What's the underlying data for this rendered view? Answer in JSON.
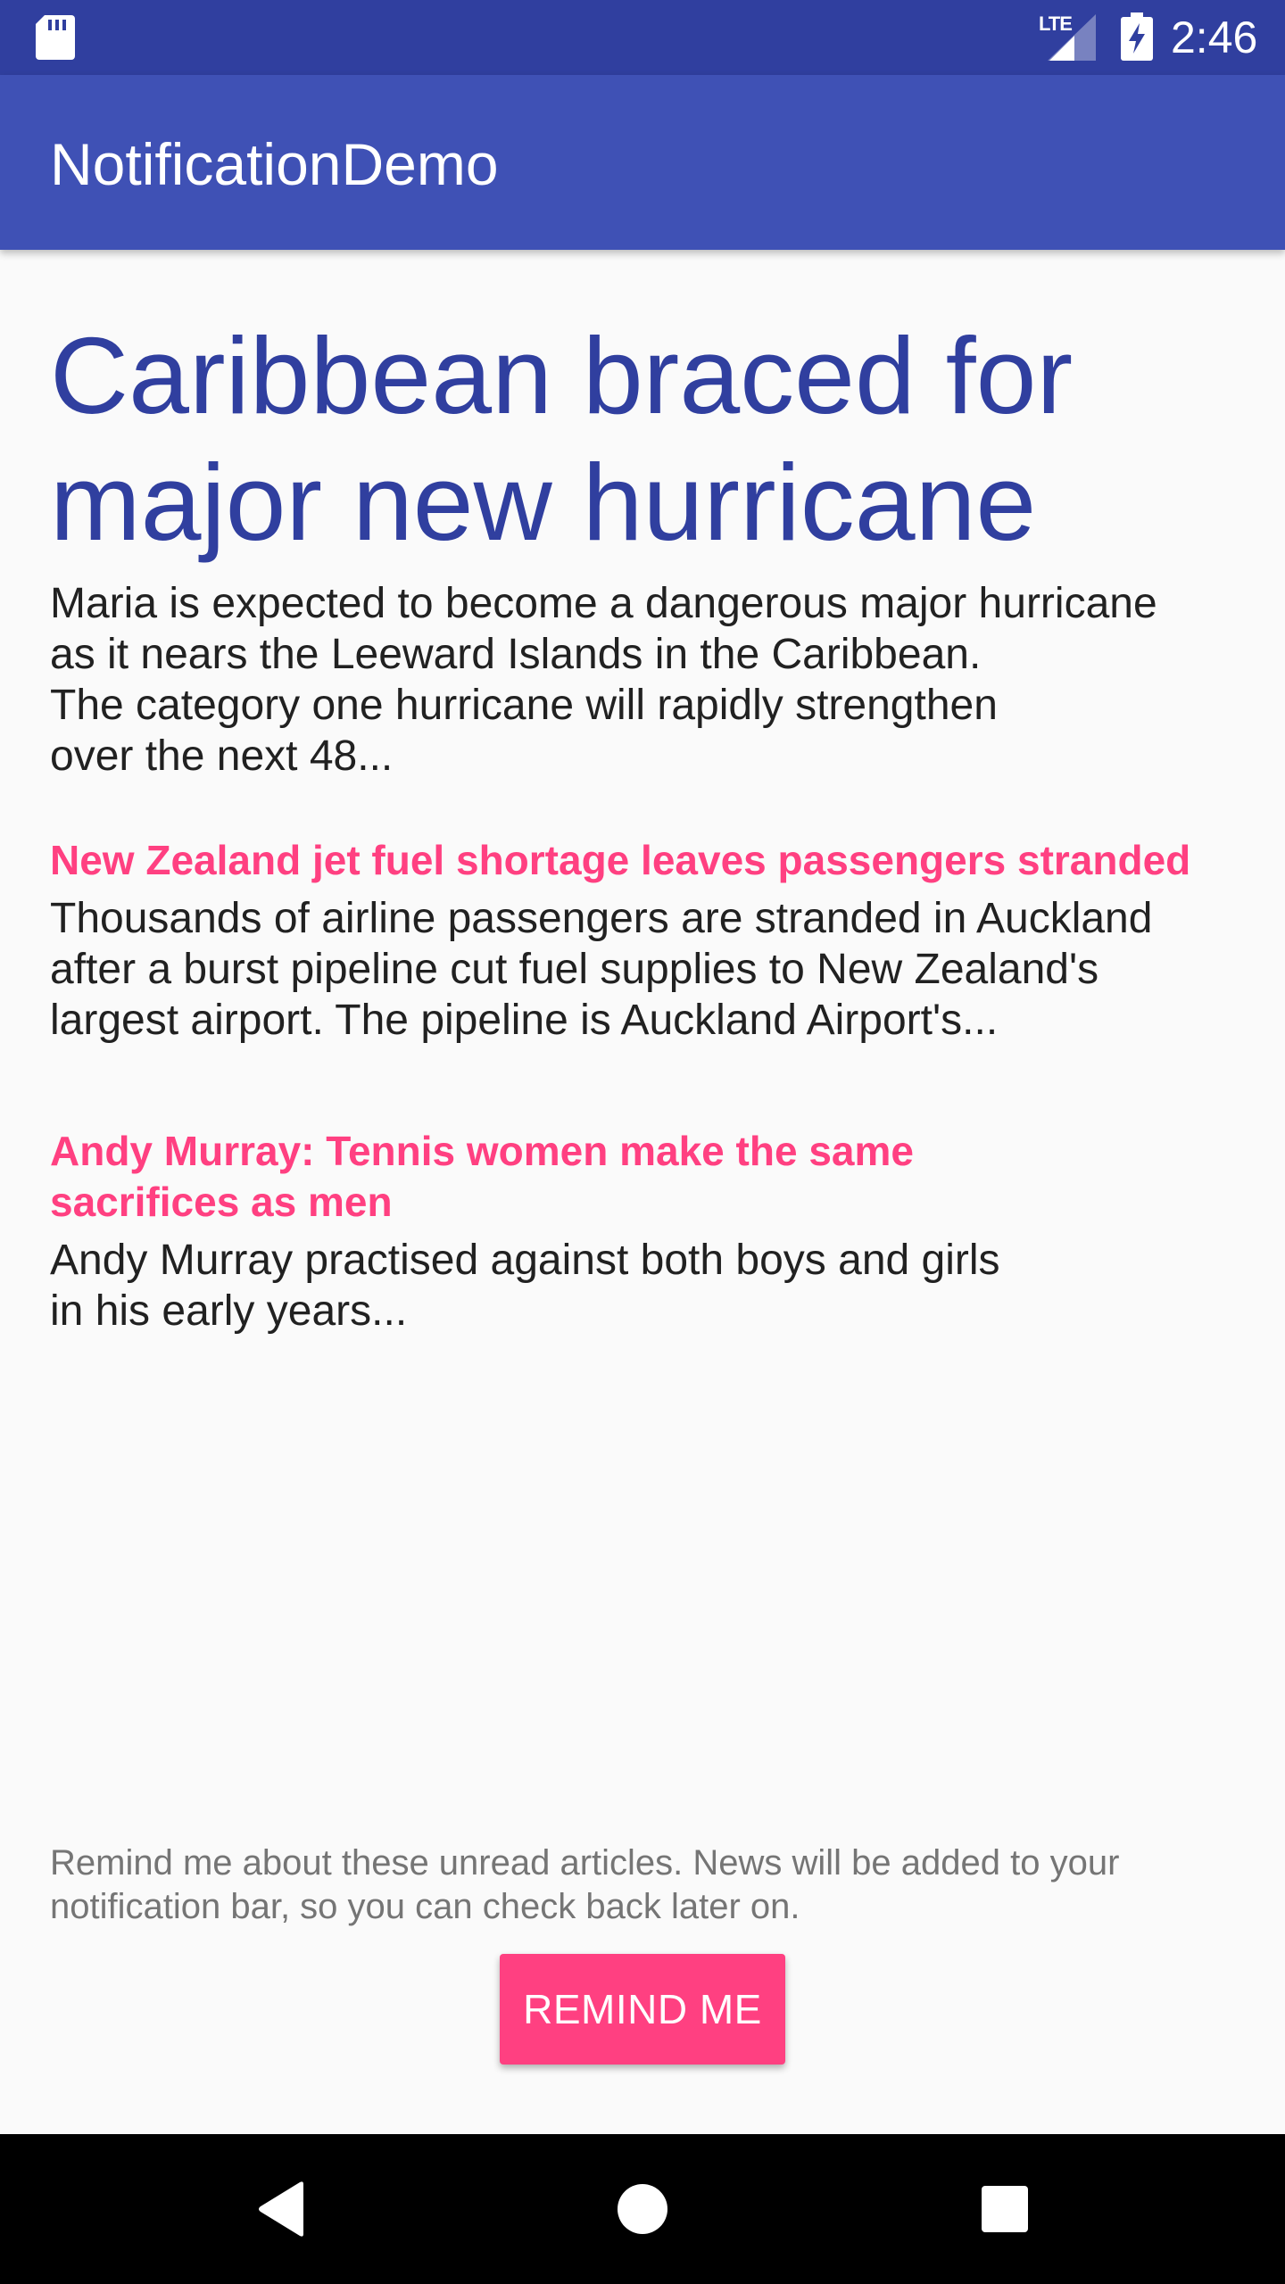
{
  "status_bar": {
    "network_label": "LTE",
    "time": "2:46",
    "icons": [
      "sd-card-icon",
      "signal-icon",
      "battery-charging-icon"
    ]
  },
  "app_bar": {
    "title": "NotificationDemo"
  },
  "headline": {
    "title": "Caribbean braced for major new hurricane",
    "body": "Maria is expected to become a dangerous major hurricane\nas it nears the Leeward Islands in the Caribbean.\nThe category one hurricane will rapidly strengthen\nover the next 48..."
  },
  "articles": [
    {
      "title": "New Zealand jet fuel shortage leaves passengers stranded",
      "body": "Thousands of airline passengers are stranded in Auckland\nafter a burst pipeline cut fuel supplies to New Zealand's\nlargest airport. The pipeline is Auckland Airport's..."
    },
    {
      "title": "Andy Murray: Tennis women make the same\nsacrifices as men",
      "body": "Andy Murray practised against both boys and girls\nin his early years..."
    }
  ],
  "reminder": {
    "text": "Remind me about these unread articles. News will be added to your\nnotification bar, so you can check back later on.",
    "button_label": "REMIND ME"
  },
  "nav_bar": {
    "icons": [
      "back-icon",
      "home-icon",
      "recents-icon"
    ]
  },
  "colors": {
    "status_bar": "#303f9f",
    "app_bar": "#3f51b5",
    "headline": "#303f9f",
    "accent": "#ff4081",
    "body_text": "#212121",
    "secondary_text": "#757575",
    "background": "#fafafa"
  }
}
